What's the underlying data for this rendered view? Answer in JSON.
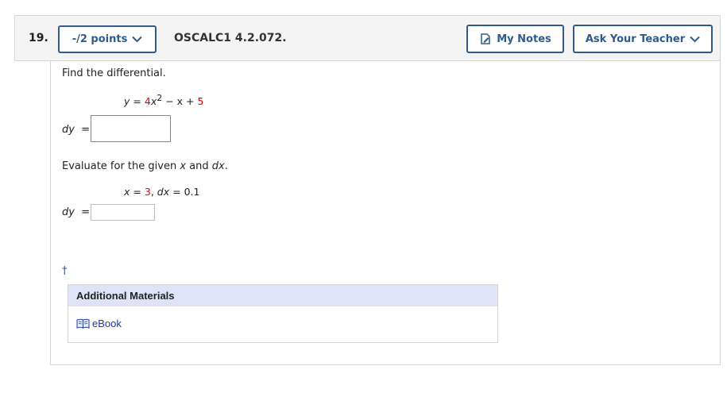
{
  "question": {
    "number": "19.",
    "points_label": "-/2 points",
    "code": "OSCALC1 4.2.072.",
    "my_notes_label": "My Notes",
    "ask_teacher_label": "Ask Your Teacher"
  },
  "problem": {
    "instruction": "Find the differential.",
    "equation": {
      "y": "y",
      "equals": "=",
      "coef": "4",
      "x_base": "x",
      "exponent": "2",
      "minus_x": "− x +",
      "const": "5"
    },
    "dy_label_1": "dy",
    "dy_equals_1": "=",
    "dy_answer_1": "",
    "evaluate_prefix": "Evaluate for the given",
    "evaluate_x": "x",
    "evaluate_and": "and",
    "evaluate_dx": "dx",
    "evaluate_period": ".",
    "given": {
      "x_label": "x",
      "x_eq": "=",
      "x_value": "3",
      "dx_label": "dx",
      "dx_eq": "=",
      "dx_value": "0.1"
    },
    "dy_label_2": "dy",
    "dy_equals_2": "=",
    "dy_answer_2": ""
  },
  "footnote": "†",
  "additional_materials": {
    "title": "Additional Materials",
    "ebook_label": "eBook"
  },
  "colors": {
    "accent": "#2e5b8c",
    "highlight": "#e00000",
    "materials_header": "#dfe3f7",
    "link": "#1a3aa6"
  }
}
